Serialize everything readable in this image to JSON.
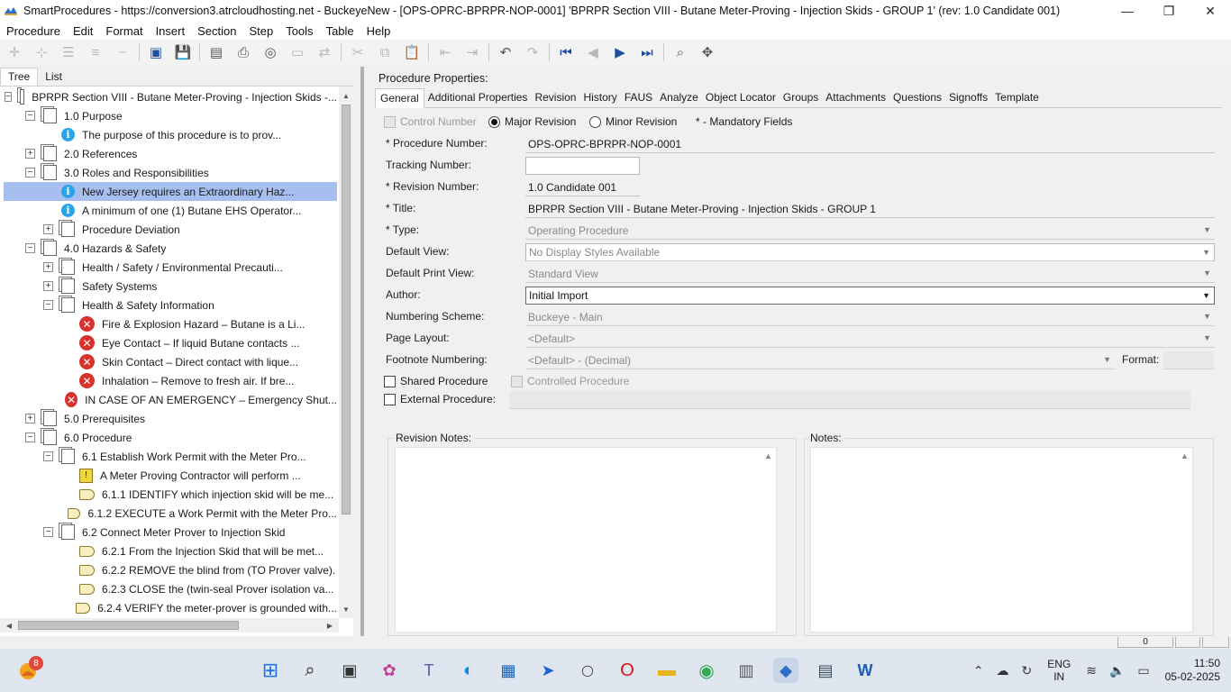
{
  "window": {
    "title": "SmartProcedures - https://conversion3.atrcloudhosting.net - BuckeyeNew - [OPS-OPRC-BPRPR-NOP-0001] 'BPRPR Section VIII - Butane Meter-Proving - Injection Skids - GROUP 1' (rev: 1.0 Candidate 001)",
    "controls": {
      "minimize": "—",
      "restore": "❐",
      "close": "✕"
    }
  },
  "menu": [
    "Procedure",
    "Edit",
    "Format",
    "Insert",
    "Section",
    "Step",
    "Tools",
    "Table",
    "Help"
  ],
  "left": {
    "tabs": [
      "Tree",
      "List"
    ],
    "tree": [
      {
        "text": "BPRPR Section VIII - Butane Meter-Proving - Injection Skids -...",
        "level": 0,
        "expander": "−",
        "icon": "doc-icon"
      },
      {
        "text": "1.0 Purpose",
        "level": 1,
        "expander": "−",
        "icon": "doc-icon"
      },
      {
        "text": "The purpose of this procedure is to prov...",
        "level": 2,
        "expander": "",
        "icon": "info-icon"
      },
      {
        "text": "2.0 References",
        "level": 1,
        "expander": "+",
        "icon": "doc-icon"
      },
      {
        "text": "3.0 Roles and Responsibilities",
        "level": 1,
        "expander": "−",
        "icon": "doc-icon"
      },
      {
        "text": "New Jersey requires an Extraordinary Haz...",
        "level": 2,
        "expander": "",
        "icon": "info-icon",
        "selected": true
      },
      {
        "text": "A minimum of one (1) Butane EHS Operator...",
        "level": 2,
        "expander": "",
        "icon": "info-icon"
      },
      {
        "text": "Procedure Deviation",
        "level": 2,
        "expander": "+",
        "icon": "doc-icon"
      },
      {
        "text": "4.0 Hazards & Safety",
        "level": 1,
        "expander": "−",
        "icon": "doc-icon"
      },
      {
        "text": "Health / Safety / Environmental Precauti...",
        "level": 2,
        "expander": "+",
        "icon": "doc-icon"
      },
      {
        "text": "Safety Systems",
        "level": 2,
        "expander": "+",
        "icon": "doc-icon"
      },
      {
        "text": "Health & Safety Information",
        "level": 2,
        "expander": "−",
        "icon": "doc-icon"
      },
      {
        "text": "Fire & Explosion Hazard – Butane is a Li...",
        "level": 3,
        "expander": "",
        "icon": "error-icon"
      },
      {
        "text": "Eye Contact – If liquid Butane contacts ...",
        "level": 3,
        "expander": "",
        "icon": "error-icon"
      },
      {
        "text": "Skin Contact – Direct contact with lique...",
        "level": 3,
        "expander": "",
        "icon": "error-icon"
      },
      {
        "text": "Inhalation – Remove to fresh air. If bre...",
        "level": 3,
        "expander": "",
        "icon": "error-icon"
      },
      {
        "text": "IN CASE OF AN EMERGENCY – Emergency Shut...",
        "level": 3,
        "expander": "",
        "icon": "error-icon"
      },
      {
        "text": "5.0 Prerequisites",
        "level": 1,
        "expander": "+",
        "icon": "doc-icon"
      },
      {
        "text": "6.0 Procedure",
        "level": 1,
        "expander": "−",
        "icon": "doc-icon"
      },
      {
        "text": "6.1 Establish Work Permit with the Meter Pro...",
        "level": 2,
        "expander": "−",
        "icon": "doc-icon"
      },
      {
        "text": "A Meter Proving Contractor will perform ...",
        "level": 3,
        "expander": "",
        "icon": "caution-icon"
      },
      {
        "text": "6.1.1 IDENTIFY which injection skid will be me...",
        "level": 3,
        "expander": "",
        "icon": "step-icon"
      },
      {
        "text": "6.1.2 EXECUTE a Work Permit with the Meter Pro...",
        "level": 3,
        "expander": "",
        "icon": "step-icon"
      },
      {
        "text": "6.2 Connect Meter Prover to Injection Skid",
        "level": 2,
        "expander": "−",
        "icon": "doc-icon"
      },
      {
        "text": "6.2.1 From the Injection Skid that will be met...",
        "level": 3,
        "expander": "",
        "icon": "step-icon"
      },
      {
        "text": "6.2.2 REMOVE the blind from (TO Prover valve).",
        "level": 3,
        "expander": "",
        "icon": "step-icon"
      },
      {
        "text": "6.2.3 CLOSE the (twin-seal Prover isolation va...",
        "level": 3,
        "expander": "",
        "icon": "step-icon"
      },
      {
        "text": "6.2.4 VERIFY the meter-prover is grounded with...",
        "level": 3,
        "expander": "",
        "icon": "step-icon"
      }
    ]
  },
  "right": {
    "header": "Procedure Properties:",
    "tabs": [
      "General",
      "Additional Properties",
      "Revision",
      "History",
      "FAUS",
      "Analyze",
      "Object Locator",
      "Groups",
      "Attachments",
      "Questions",
      "Signoffs",
      "Template"
    ],
    "control_number": "Control Number",
    "major_revision": "Major Revision",
    "minor_revision": "Minor Revision",
    "mandatory_note": "* - Mandatory Fields",
    "fields": {
      "procedure_number": {
        "label": "* Procedure Number:",
        "value": "OPS-OPRC-BPRPR-NOP-0001"
      },
      "tracking_number": {
        "label": "Tracking Number:",
        "value": ""
      },
      "revision_number": {
        "label": "* Revision Number:",
        "value": "1.0 Candidate 001"
      },
      "title": {
        "label": "* Title:",
        "value": "BPRPR Section VIII - Butane Meter-Proving - Injection Skids - GROUP 1"
      },
      "type": {
        "label": "* Type:",
        "value": "Operating Procedure"
      },
      "default_view": {
        "label": "Default View:",
        "value": "No Display Styles Available"
      },
      "default_print_view": {
        "label": "Default Print View:",
        "value": "Standard View"
      },
      "author": {
        "label": "Author:",
        "value": "Initial Import"
      },
      "numbering_scheme": {
        "label": "Numbering Scheme:",
        "value": "Buckeye - Main"
      },
      "page_layout": {
        "label": "Page Layout:",
        "value": "<Default>"
      },
      "footnote_numbering": {
        "label": "Footnote Numbering:",
        "value": "<Default> - (Decimal)"
      },
      "format": {
        "label": "Format:",
        "value": ""
      }
    },
    "shared_procedure": "Shared Procedure",
    "controlled_procedure": "Controlled Procedure",
    "external_procedure": "External Procedure:",
    "revision_notes": "Revision Notes:",
    "notes": "Notes:"
  },
  "status": {
    "value": "0"
  },
  "taskbar": {
    "badge": "8",
    "lang_line1": "ENG",
    "lang_line2": "IN",
    "time": "11:50",
    "date": "05-02-2025"
  }
}
